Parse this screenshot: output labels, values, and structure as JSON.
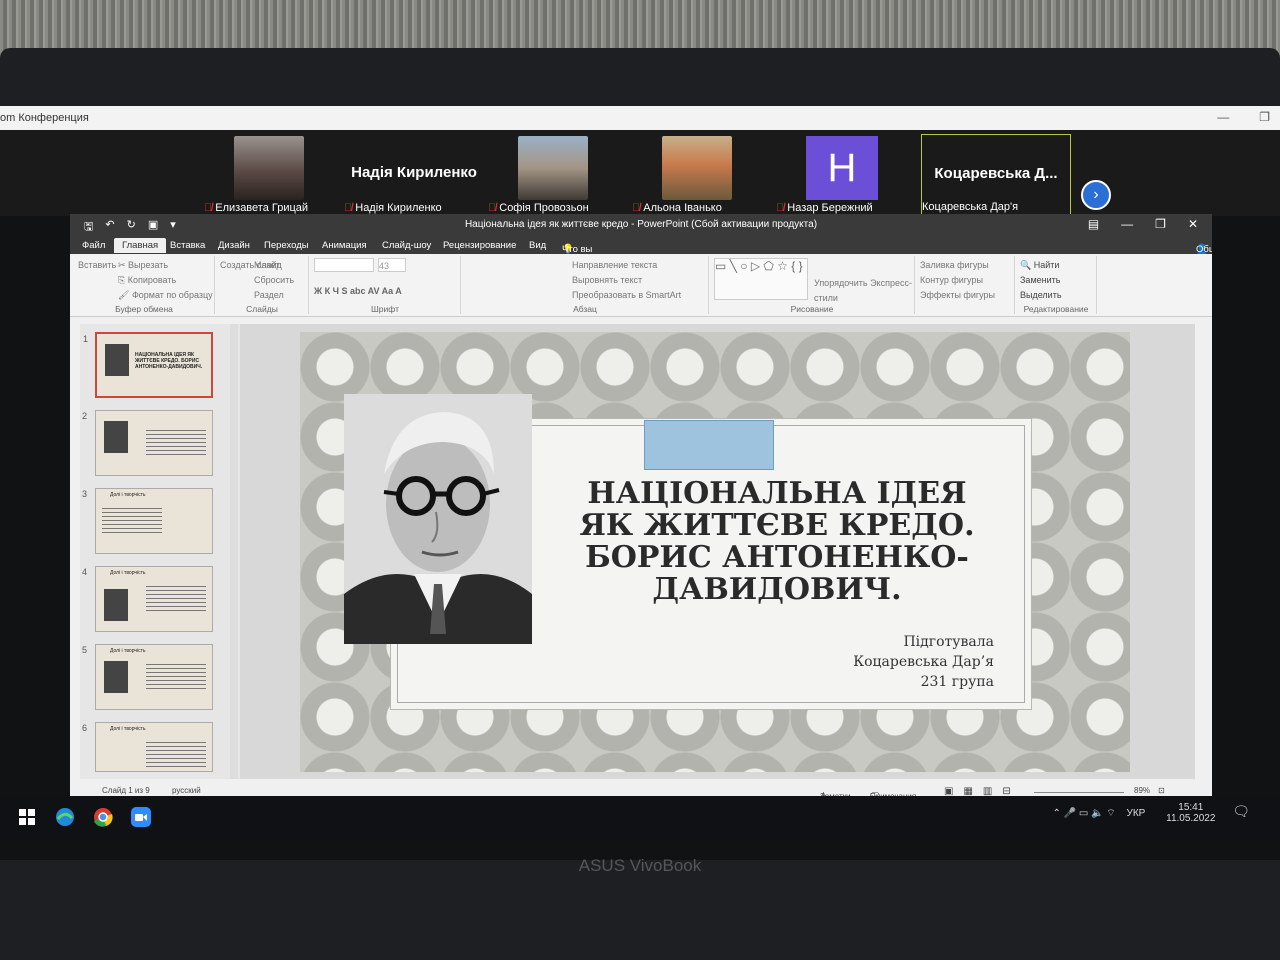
{
  "zoom": {
    "window_title": "om Конференция",
    "participants": [
      {
        "name": "Елизавета Грицай",
        "display_name": "",
        "has_video": true,
        "muted": true
      },
      {
        "name": "Надія Кириленко",
        "display_name": "Надія Кириленко",
        "has_video": false,
        "muted": true
      },
      {
        "name": "Софія Провозьон",
        "display_name": "",
        "has_video": true,
        "muted": true
      },
      {
        "name": "Альона Іванько",
        "display_name": "",
        "has_video": true,
        "muted": true
      },
      {
        "name": "Назар Бережний",
        "display_name": "",
        "avatar_letter": "H",
        "has_video": false,
        "muted": true
      },
      {
        "name": "Коцаревська Дар'я",
        "display_name": "Коцаревська Д...",
        "has_video": false,
        "muted": false,
        "active": true
      }
    ]
  },
  "ppt": {
    "title": "Національна ідея як життєве кредо - PowerPoint (Сбой активации продукта)",
    "tabs": [
      "Файл",
      "Главная",
      "Вставка",
      "Дизайн",
      "Переходы",
      "Анимация",
      "Слайд-шоу",
      "Рецензирование",
      "Вид"
    ],
    "selected_tab": "Главная",
    "tell_me": "Что вы хотите сделать?",
    "share": "Общий доступ",
    "ribbon": [
      {
        "label": "Буфер обмена",
        "items": [
          "Вставить",
          "Вырезать",
          "Копировать",
          "Формат по образцу"
        ]
      },
      {
        "label": "Слайды",
        "items": [
          "Создать слайд",
          "Макет",
          "Сбросить",
          "Раздел"
        ]
      },
      {
        "label": "Шрифт",
        "items": [
          "43",
          "Ж  К  Ч  S  abc  AV  Aa  A"
        ]
      },
      {
        "label": "Абзац",
        "items": [
          "Направление текста",
          "Выровнять текст",
          "Преобразовать в SmartArt"
        ]
      },
      {
        "label": "Рисование",
        "items": [
          "Упорядочить",
          "Экспресс-стили"
        ]
      },
      {
        "label": "",
        "items": [
          "Заливка фигуры",
          "Контур фигуры",
          "Эффекты фигуры"
        ]
      },
      {
        "label": "Редактирование",
        "items": [
          "Найти",
          "Заменить",
          "Выделить"
        ]
      }
    ],
    "thumbs": [
      {
        "num": "1",
        "title": "НАЦІОНАЛЬНА ІДЕЯ ЯК ЖИТТЄВЕ КРЕДО. БОРИС АНТОНЕНКО-ДАВИДОВИЧ."
      },
      {
        "num": "2",
        "title": ""
      },
      {
        "num": "3",
        "title": "Долі і творчість"
      },
      {
        "num": "4",
        "title": "Долі і творчість"
      },
      {
        "num": "5",
        "title": "Долі і творчість"
      },
      {
        "num": "6",
        "title": "Долі і творчість"
      }
    ],
    "slide": {
      "title": "НАЦІОНАЛЬНА ІДЕЯ ЯК ЖИТТЄВЕ КРЕДО. БОРИС АНТОНЕНКО-ДАВИДОВИЧ.",
      "prepared_label": "Підготувала",
      "author": "Коцаревська Дар’я",
      "group": "231 група"
    },
    "status": {
      "slide_counter": "Слайд 1 из 9",
      "language": "русский",
      "notes": "Заметки",
      "comments": "Примечания",
      "zoom": "89%"
    }
  },
  "taskbar": {
    "language": "УКР",
    "time": "15:41",
    "date": "11.05.2022"
  },
  "laptop_brand": "ASUS VivoBook"
}
